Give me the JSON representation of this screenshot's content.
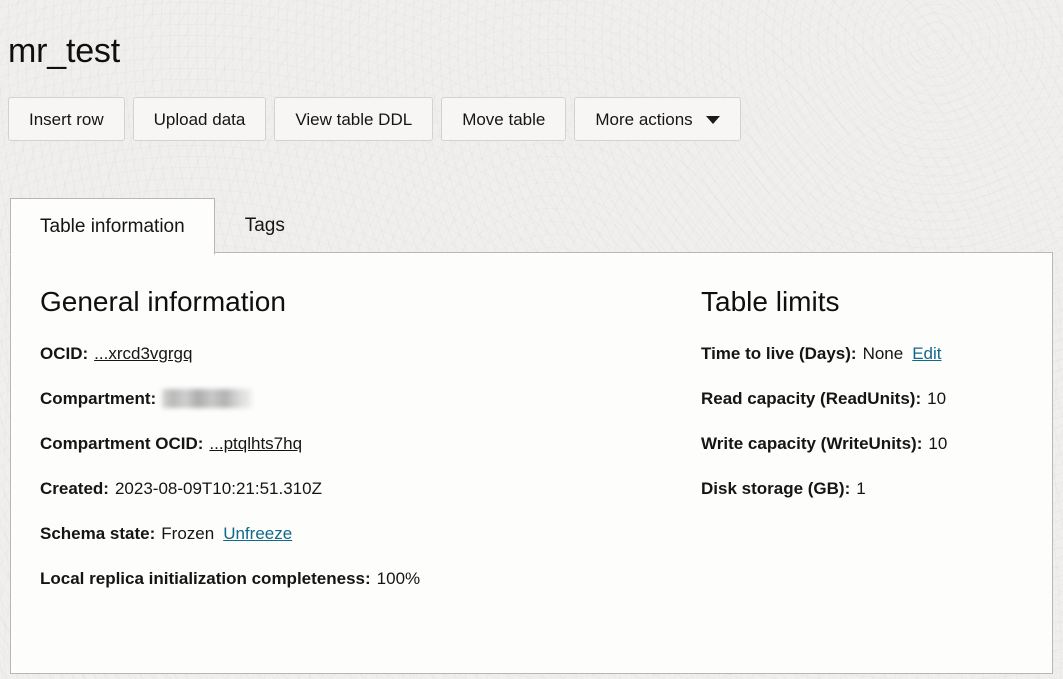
{
  "header": {
    "title": "mr_test"
  },
  "toolbar": {
    "buttons": [
      {
        "label": "Insert row"
      },
      {
        "label": "Upload data"
      },
      {
        "label": "View table DDL"
      },
      {
        "label": "Move table"
      },
      {
        "label": "More actions",
        "icon": "chevron-down-icon"
      }
    ]
  },
  "tabs": [
    {
      "label": "Table information",
      "active": true
    },
    {
      "label": "Tags",
      "active": false
    }
  ],
  "general_information": {
    "heading": "General information",
    "rows": [
      {
        "label": "OCID:",
        "value": "...xrcd3vgrgq",
        "value_kind": "link-dark"
      },
      {
        "label": "Compartment:",
        "value": "",
        "value_kind": "redacted"
      },
      {
        "label": "Compartment OCID:",
        "value": "...ptqlhts7hq",
        "value_kind": "link-dark"
      },
      {
        "label": "Created:",
        "value": "2023-08-09T10:21:51.310Z",
        "value_kind": "text"
      },
      {
        "label": "Schema state:",
        "value": "Frozen",
        "value_kind": "text",
        "action": "Unfreeze"
      },
      {
        "label": "Local replica initialization completeness:",
        "value": "100%",
        "value_kind": "text"
      }
    ]
  },
  "table_limits": {
    "heading": "Table limits",
    "rows": [
      {
        "label": "Time to live (Days):",
        "value": "None",
        "action": "Edit"
      },
      {
        "label": "Read capacity (ReadUnits):",
        "value": "10"
      },
      {
        "label": "Write capacity (WriteUnits):",
        "value": "10"
      },
      {
        "label": "Disk storage (GB):",
        "value": "1"
      }
    ]
  },
  "colors": {
    "page_background": "#f0efed",
    "panel_background": "#fdfdfb",
    "text": "#161513",
    "link_accent": "#10698b",
    "border": "#b9b7b2"
  }
}
